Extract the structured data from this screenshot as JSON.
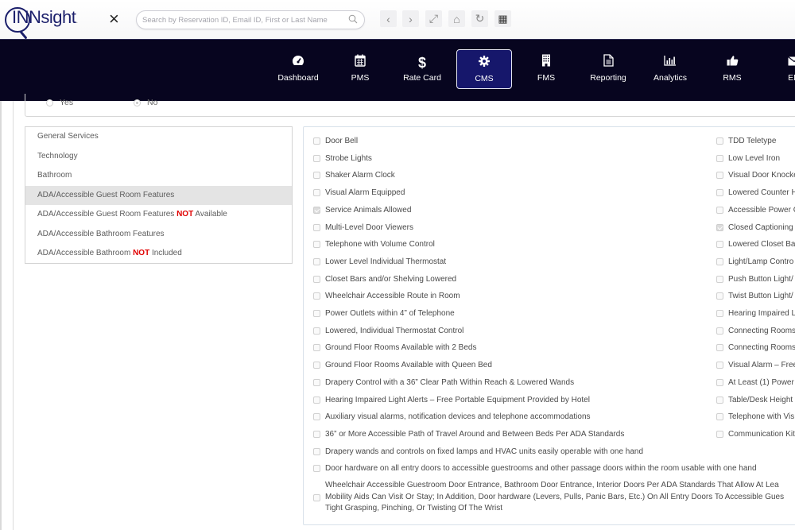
{
  "app": {
    "logo_text": "INNsight",
    "close_label": "×"
  },
  "search": {
    "placeholder": "Search by Reservation ID, Email ID, First or Last Name",
    "value": ""
  },
  "toolbar": [
    {
      "name": "back-button",
      "icon": "chevron-left-icon",
      "glyph": "‹"
    },
    {
      "name": "forward-button",
      "icon": "chevron-right-icon",
      "glyph": "›"
    },
    {
      "name": "fullscreen-button",
      "icon": "expand-icon",
      "glyph": "⤢"
    },
    {
      "name": "home-button",
      "icon": "home-icon",
      "glyph": "⌂"
    },
    {
      "name": "refresh-button",
      "icon": "refresh-icon",
      "glyph": "↻"
    },
    {
      "name": "apps-button",
      "icon": "grid-icon",
      "glyph": "▦"
    }
  ],
  "nav": {
    "active": "CMS",
    "items": [
      {
        "label": "Dashboard",
        "icon": "gauge-icon"
      },
      {
        "label": "PMS",
        "icon": "calendar-icon"
      },
      {
        "label": "Rate Card",
        "icon": "dollar-icon"
      },
      {
        "label": "CMS",
        "icon": "gear-icon"
      },
      {
        "label": "FMS",
        "icon": "building-icon"
      },
      {
        "label": "Reporting",
        "icon": "document-icon"
      },
      {
        "label": "Analytics",
        "icon": "bar-chart-icon"
      },
      {
        "label": "RMS",
        "icon": "thumbs-up-icon"
      },
      {
        "label": "EM",
        "icon": "envelope-icon"
      }
    ]
  },
  "radio_group": {
    "options": [
      {
        "label": "Yes",
        "selected": false
      },
      {
        "label": "No",
        "selected": true
      }
    ]
  },
  "categories": {
    "active_index": 3,
    "items": [
      {
        "pre": "General Services",
        "emph": "",
        "post": ""
      },
      {
        "pre": "Technology",
        "emph": "",
        "post": ""
      },
      {
        "pre": "Bathroom",
        "emph": "",
        "post": ""
      },
      {
        "pre": "ADA/Accessible Guest Room Features",
        "emph": "",
        "post": ""
      },
      {
        "pre": "ADA/Accessible Guest Room Features ",
        "emph": "NOT",
        "post": " Available"
      },
      {
        "pre": "ADA/Accessible Bathroom Features",
        "emph": "",
        "post": ""
      },
      {
        "pre": "ADA/Accessible Bathroom ",
        "emph": "NOT",
        "post": " Included"
      }
    ],
    "emphasis_color": "#e00000"
  },
  "features": {
    "left_column": [
      {
        "label": "Door Bell",
        "checked": false
      },
      {
        "label": "Strobe Lights",
        "checked": false
      },
      {
        "label": "Shaker Alarm Clock",
        "checked": false
      },
      {
        "label": "Visual Alarm Equipped",
        "checked": false
      },
      {
        "label": "Service Animals Allowed",
        "checked": true
      },
      {
        "label": "Multi-Level Door Viewers",
        "checked": false
      },
      {
        "label": "Telephone with Volume Control",
        "checked": false
      },
      {
        "label": "Lower Level Individual Thermostat",
        "checked": false
      },
      {
        "label": "Closet Bars and/or Shelving Lowered",
        "checked": false
      },
      {
        "label": "Wheelchair Accessible Route in Room",
        "checked": false
      },
      {
        "label": "Power Outlets within 4” of Telephone",
        "checked": false
      },
      {
        "label": "Lowered, Individual Thermostat Control",
        "checked": false
      },
      {
        "label": "Ground Floor Rooms Available with 2 Beds",
        "checked": false
      },
      {
        "label": "Ground Floor Rooms Available with Queen Bed",
        "checked": false
      },
      {
        "label": "Drapery Control with a 36” Clear Path Within Reach & Lowered Wands",
        "checked": false
      },
      {
        "label": "Hearing Impaired Light Alerts – Free Portable Equipment Provided by Hotel",
        "checked": false
      },
      {
        "label": "Auxiliary visual alarms, notification devices and telephone accommodations",
        "checked": false
      },
      {
        "label": "36” or More Accessible Path of Travel Around and Between Beds Per ADA Standards",
        "checked": false
      },
      {
        "label": "Drapery wands and controls on fixed lamps and HVAC units easily operable with one hand",
        "checked": false
      },
      {
        "label": "Door hardware on all entry doors to accessible guestrooms and other passage doors within the room usable with one hand",
        "checked": false
      }
    ],
    "multiline_item": {
      "lines": [
        "Wheelchair Accessible Guestroom Door Entrance, Bathroom Door Entrance, Interior Doors Per ADA Standards That Allow At Lea",
        "Mobility Aids Can Visit Or Stay; In Addition, Door hardware (Levers, Pulls, Panic Bars, Etc.) On All Entry Doors To Accessible Gues",
        "Tight Grasping, Pinching, Or Twisting Of The Wrist"
      ],
      "checked": false
    },
    "right_column": [
      {
        "label": "TDD Teletype",
        "checked": false
      },
      {
        "label": "Low Level Iron",
        "checked": false
      },
      {
        "label": "Visual Door Knocke",
        "checked": false
      },
      {
        "label": "Lowered Counter H",
        "checked": false
      },
      {
        "label": "Accessible Power C",
        "checked": false
      },
      {
        "label": "Closed Captioning",
        "checked": true
      },
      {
        "label": "Lowered Closet Ba",
        "checked": false
      },
      {
        "label": "Light/Lamp Contro",
        "checked": false
      },
      {
        "label": "Push Button Light/",
        "checked": false
      },
      {
        "label": "Twist Button Light/",
        "checked": false
      },
      {
        "label": "Hearing Impaired L",
        "checked": false
      },
      {
        "label": "Connecting Rooms",
        "checked": false
      },
      {
        "label": "Connecting Rooms",
        "checked": false
      },
      {
        "label": "Visual Alarm – Free",
        "checked": false
      },
      {
        "label": "At Least (1) Power C",
        "checked": false
      },
      {
        "label": "Table/Desk Height",
        "checked": false
      },
      {
        "label": "Telephone with Vis",
        "checked": false
      },
      {
        "label": "Communication Kit",
        "checked": false
      }
    ]
  },
  "colors": {
    "navbar_bg": "#07051f",
    "nav_active_bg": "#16176b",
    "brand": "#1b1f6b",
    "emphasis": "#e00000"
  }
}
